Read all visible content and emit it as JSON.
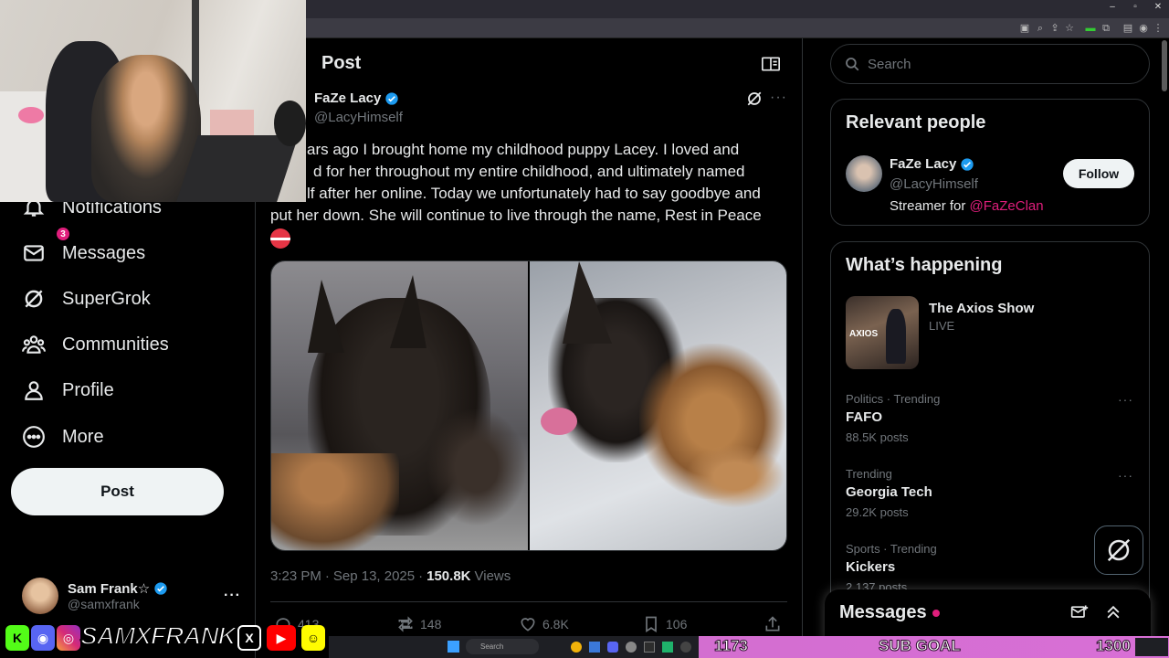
{
  "colors": {
    "accent": "#e01e7c",
    "bg": "#000000",
    "text": "#e7e9ea",
    "muted": "#71767b",
    "border": "#2f3336",
    "verified": "#1d9bf0",
    "subgoal": "#d86fd6"
  },
  "sidebar": {
    "items": [
      {
        "label": "Notifications",
        "icon": "bell-icon"
      },
      {
        "label": "Messages",
        "icon": "envelope-icon",
        "badge": "3"
      },
      {
        "label": "SuperGrok",
        "icon": "grok-icon"
      },
      {
        "label": "Communities",
        "icon": "people-icon"
      },
      {
        "label": "Profile",
        "icon": "person-icon"
      },
      {
        "label": "More",
        "icon": "more-circle-icon"
      }
    ],
    "post_label": "Post",
    "account": {
      "name": "Sam Frank☆",
      "handle": "@samxfrank",
      "more": "···"
    }
  },
  "main": {
    "title": "Post",
    "author": {
      "name": "FaZe Lacy",
      "handle": "@LacyHimself"
    },
    "more": "···",
    "text_lines": [
      "ars ago I brought home my childhood puppy Lacey. I loved and",
      "d for her throughout my entire childhood, and ultimately named",
      "lf after her online. Today we unfortunately had to say goodbye and",
      "put her down. She will continue to live through the name, Rest in Peace"
    ],
    "meta": {
      "time": "3:23 PM",
      "dot1": "·",
      "date": "Sep 13, 2025",
      "dot2": "·",
      "views": "150.8K",
      "views_label": "Views"
    },
    "actions": {
      "replies": "413",
      "reposts": "148",
      "likes": "6.8K",
      "bookmarks": "106"
    }
  },
  "right": {
    "search_placeholder": "Search",
    "relevant_title": "Relevant people",
    "person": {
      "name": "FaZe Lacy",
      "handle": "@LacyHimself",
      "bio_prefix": "Streamer for ",
      "bio_link": "@FaZeClan",
      "follow_label": "Follow"
    },
    "happening_title": "What’s happening",
    "live": {
      "title": "The Axios Show",
      "status": "LIVE",
      "thumb_text": "AXIOS"
    },
    "trends": [
      {
        "category": "Politics · Trending",
        "name": "FAFO",
        "count": "88.5K posts"
      },
      {
        "category": "Trending",
        "name": "Georgia Tech",
        "count": "29.2K posts"
      },
      {
        "category": "Sports · Trending",
        "name": "Kickers",
        "count": "2,137 posts"
      }
    ],
    "messages_title": "Messages"
  },
  "overlay": {
    "streamer_name": "SAMXFRANK",
    "sub_current": "1173",
    "sub_label": "SUB GOAL",
    "sub_target": "1300",
    "taskbar_search": "Search"
  }
}
